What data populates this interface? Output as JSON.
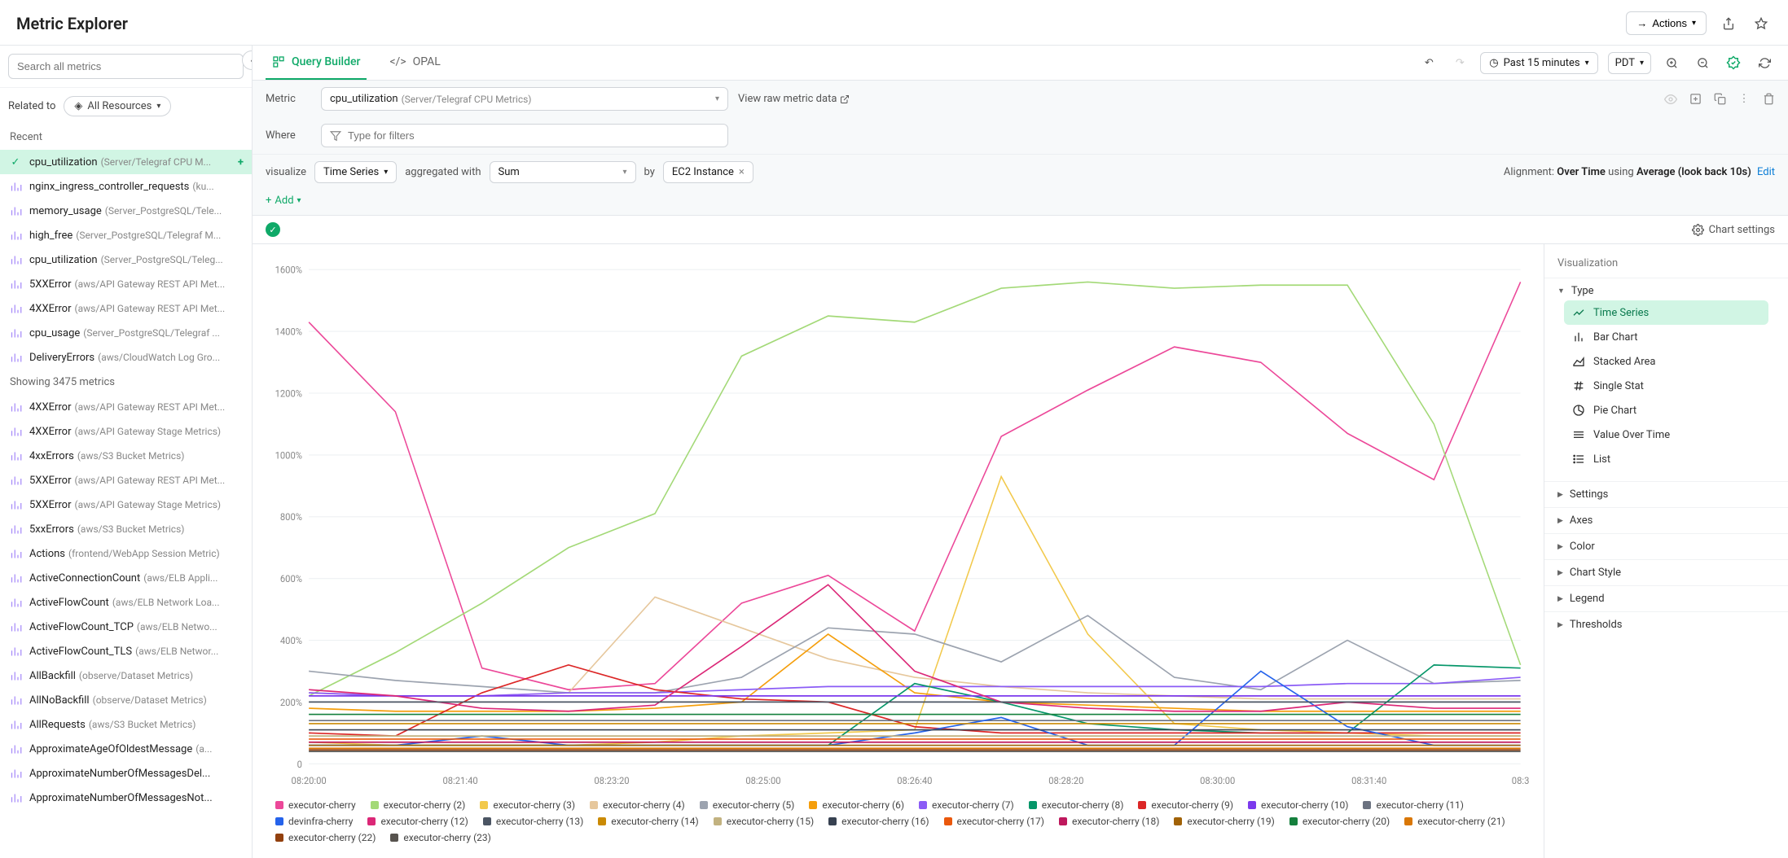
{
  "header": {
    "title": "Metric Explorer",
    "actions_label": "Actions"
  },
  "sidebar": {
    "search_placeholder": "Search all metrics",
    "related_label": "Related to",
    "resources_label": "All Resources",
    "recent_label": "Recent",
    "recent": [
      {
        "name": "cpu_utilization",
        "source": "(Server/Telegraf CPU M...",
        "selected": true,
        "check": true
      },
      {
        "name": "nginx_ingress_controller_requests",
        "source": "(ku..."
      },
      {
        "name": "memory_usage",
        "source": "(Server_PostgreSQL/Tele..."
      },
      {
        "name": "high_free",
        "source": "(Server_PostgreSQL/Telegraf M..."
      },
      {
        "name": "cpu_utilization",
        "source": "(Server_PostgreSQL/Teleg..."
      },
      {
        "name": "5XXError",
        "source": "(aws/API Gateway REST API Met..."
      },
      {
        "name": "4XXError",
        "source": "(aws/API Gateway REST API Met..."
      },
      {
        "name": "cpu_usage",
        "source": "(Server_PostgreSQL/Telegraf ..."
      },
      {
        "name": "DeliveryErrors",
        "source": "(aws/CloudWatch Log Gro..."
      }
    ],
    "showing_label": "Showing 3475 metrics",
    "all": [
      {
        "name": "4XXError",
        "source": "(aws/API Gateway REST API Met..."
      },
      {
        "name": "4XXError",
        "source": "(aws/API Gateway Stage Metrics)"
      },
      {
        "name": "4xxErrors",
        "source": "(aws/S3 Bucket Metrics)"
      },
      {
        "name": "5XXError",
        "source": "(aws/API Gateway REST API Met..."
      },
      {
        "name": "5XXError",
        "source": "(aws/API Gateway Stage Metrics)"
      },
      {
        "name": "5xxErrors",
        "source": "(aws/S3 Bucket Metrics)"
      },
      {
        "name": "Actions",
        "source": "(frontend/WebApp Session Metric)"
      },
      {
        "name": "ActiveConnectionCount",
        "source": "(aws/ELB Appli..."
      },
      {
        "name": "ActiveFlowCount",
        "source": "(aws/ELB Network Loa..."
      },
      {
        "name": "ActiveFlowCount_TCP",
        "source": "(aws/ELB Netwo..."
      },
      {
        "name": "ActiveFlowCount_TLS",
        "source": "(aws/ELB Networ..."
      },
      {
        "name": "AllBackfill",
        "source": "(observe/Dataset Metrics)"
      },
      {
        "name": "AllNoBackfill",
        "source": "(observe/Dataset Metrics)"
      },
      {
        "name": "AllRequests",
        "source": "(aws/S3 Bucket Metrics)"
      },
      {
        "name": "ApproximateAgeOfOldestMessage",
        "source": "(a..."
      },
      {
        "name": "ApproximateNumberOfMessagesDel...",
        "source": ""
      },
      {
        "name": "ApproximateNumberOfMessagesNot...",
        "source": ""
      }
    ]
  },
  "tabs": {
    "builder": "Query Builder",
    "opal": "OPAL",
    "time_range": "Past 15 minutes",
    "tz": "PDT"
  },
  "builder": {
    "metric_label": "Metric",
    "metric_name": "cpu_utilization",
    "metric_source": "(Server/Telegraf CPU Metrics)",
    "view_raw": "View raw metric data",
    "where_label": "Where",
    "filter_placeholder": "Type for filters",
    "visualize_label": "visualize",
    "viz_value": "Time Series",
    "agg_label": "aggregated with",
    "agg_value": "Sum",
    "by_label": "by",
    "by_chip": "EC2 Instance",
    "alignment_prefix": "Alignment:",
    "alignment_over": "Over Time",
    "alignment_using": "using",
    "alignment_avg": "Average (look back 10s)",
    "alignment_edit": "Edit",
    "add_label": "Add"
  },
  "status": {
    "chart_settings": "Chart settings"
  },
  "viz_panel": {
    "title": "Visualization",
    "type_label": "Type",
    "types": [
      "Time Series",
      "Bar Chart",
      "Stacked Area",
      "Single Stat",
      "Pie Chart",
      "Value Over Time",
      "List"
    ],
    "sections": [
      "Settings",
      "Axes",
      "Color",
      "Chart Style",
      "Legend",
      "Thresholds"
    ]
  },
  "chart_data": {
    "type": "line",
    "ylabel": "",
    "ylim": [
      0,
      1600
    ],
    "y_ticks": [
      "0",
      "200%",
      "400%",
      "600%",
      "800%",
      "1000%",
      "1200%",
      "1400%",
      "1600%"
    ],
    "x_ticks": [
      "08:20:00",
      "08:21:40",
      "08:23:20",
      "08:25:00",
      "08:26:40",
      "08:28:20",
      "08:30:00",
      "08:31:40",
      "08:3"
    ],
    "x": [
      0,
      1,
      2,
      3,
      4,
      5,
      6,
      7,
      8,
      9,
      10,
      11,
      12,
      13,
      14
    ],
    "series": [
      {
        "name": "executor-cherry",
        "color": "#ec4899",
        "values": [
          1430,
          1140,
          310,
          240,
          260,
          520,
          610,
          430,
          1060,
          1210,
          1350,
          1300,
          1070,
          920,
          1560
        ]
      },
      {
        "name": "executor-cherry (2)",
        "color": "#a3d977",
        "values": [
          220,
          360,
          520,
          700,
          810,
          1320,
          1450,
          1430,
          1540,
          1560,
          1540,
          1550,
          1550,
          1100,
          320
        ]
      },
      {
        "name": "executor-cherry (3)",
        "color": "#f2c94c",
        "values": [
          70,
          60,
          60,
          60,
          70,
          90,
          100,
          110,
          930,
          420,
          130,
          110,
          100,
          90,
          90
        ]
      },
      {
        "name": "executor-cherry (4)",
        "color": "#e6c79c",
        "values": [
          230,
          220,
          220,
          230,
          540,
          440,
          340,
          280,
          250,
          230,
          220,
          210,
          210,
          210,
          210
        ]
      },
      {
        "name": "executor-cherry (5)",
        "color": "#9ca3af",
        "values": [
          300,
          270,
          250,
          230,
          230,
          280,
          440,
          420,
          330,
          480,
          280,
          240,
          400,
          260,
          270
        ]
      },
      {
        "name": "executor-cherry (6)",
        "color": "#f59e0b",
        "values": [
          180,
          170,
          170,
          170,
          180,
          200,
          420,
          230,
          200,
          190,
          180,
          170,
          170,
          170,
          170
        ]
      },
      {
        "name": "executor-cherry (7)",
        "color": "#8b5cf6",
        "values": [
          230,
          220,
          220,
          230,
          230,
          240,
          250,
          250,
          250,
          250,
          250,
          250,
          260,
          260,
          280
        ]
      },
      {
        "name": "executor-cherry (8)",
        "color": "#059669",
        "values": [
          60,
          60,
          60,
          60,
          60,
          60,
          60,
          260,
          200,
          130,
          110,
          100,
          100,
          320,
          310
        ]
      },
      {
        "name": "executor-cherry (9)",
        "color": "#dc2626",
        "values": [
          100,
          90,
          230,
          320,
          240,
          210,
          200,
          120,
          100,
          100,
          100,
          100,
          100,
          100,
          100
        ]
      },
      {
        "name": "executor-cherry (10)",
        "color": "#7c3aed",
        "values": [
          220,
          220,
          220,
          220,
          220,
          220,
          220,
          220,
          220,
          220,
          220,
          220,
          220,
          220,
          220
        ]
      },
      {
        "name": "executor-cherry (11)",
        "color": "#6b7280",
        "values": [
          140,
          140,
          140,
          140,
          140,
          140,
          140,
          140,
          140,
          140,
          140,
          140,
          140,
          140,
          140
        ]
      },
      {
        "name": "devinfra-cherry",
        "color": "#2563eb",
        "values": [
          60,
          60,
          90,
          60,
          60,
          60,
          60,
          100,
          150,
          60,
          60,
          300,
          120,
          60,
          60
        ]
      },
      {
        "name": "executor-cherry (12)",
        "color": "#db2777",
        "values": [
          240,
          220,
          180,
          170,
          190,
          380,
          580,
          300,
          200,
          180,
          170,
          170,
          200,
          180,
          180
        ]
      },
      {
        "name": "executor-cherry (13)",
        "color": "#4b5563",
        "values": [
          200,
          200,
          200,
          200,
          200,
          200,
          200,
          200,
          200,
          200,
          200,
          200,
          200,
          200,
          200
        ]
      },
      {
        "name": "executor-cherry (14)",
        "color": "#ca8a04",
        "values": [
          130,
          130,
          130,
          130,
          130,
          130,
          130,
          130,
          130,
          130,
          130,
          130,
          130,
          130,
          130
        ]
      },
      {
        "name": "executor-cherry (15)",
        "color": "#c2b280",
        "values": [
          90,
          90,
          90,
          90,
          90,
          90,
          90,
          90,
          90,
          90,
          90,
          90,
          90,
          90,
          90
        ]
      },
      {
        "name": "executor-cherry (16)",
        "color": "#374151",
        "values": [
          110,
          110,
          110,
          110,
          110,
          110,
          110,
          110,
          110,
          110,
          110,
          110,
          110,
          110,
          110
        ]
      },
      {
        "name": "executor-cherry (17)",
        "color": "#ea580c",
        "values": [
          80,
          80,
          80,
          80,
          80,
          80,
          80,
          80,
          80,
          80,
          80,
          80,
          80,
          80,
          80
        ]
      },
      {
        "name": "executor-cherry (18)",
        "color": "#be185d",
        "values": [
          70,
          70,
          70,
          70,
          70,
          70,
          70,
          70,
          70,
          70,
          70,
          70,
          70,
          70,
          70
        ]
      },
      {
        "name": "executor-cherry (19)",
        "color": "#a16207",
        "values": [
          60,
          60,
          60,
          60,
          60,
          60,
          60,
          60,
          60,
          60,
          60,
          60,
          60,
          60,
          60
        ]
      },
      {
        "name": "executor-cherry (20)",
        "color": "#15803d",
        "values": [
          160,
          160,
          160,
          160,
          160,
          160,
          160,
          160,
          160,
          160,
          160,
          160,
          160,
          160,
          160
        ]
      },
      {
        "name": "executor-cherry (21)",
        "color": "#d97706",
        "values": [
          50,
          50,
          50,
          50,
          50,
          50,
          50,
          50,
          50,
          50,
          50,
          50,
          50,
          50,
          50
        ]
      },
      {
        "name": "executor-cherry (22)",
        "color": "#92400e",
        "values": [
          45,
          45,
          45,
          45,
          45,
          45,
          45,
          45,
          45,
          45,
          45,
          45,
          45,
          45,
          45
        ]
      },
      {
        "name": "executor-cherry (23)",
        "color": "#57534e",
        "values": [
          40,
          40,
          40,
          40,
          40,
          40,
          40,
          40,
          40,
          40,
          40,
          40,
          40,
          40,
          40
        ]
      }
    ]
  }
}
